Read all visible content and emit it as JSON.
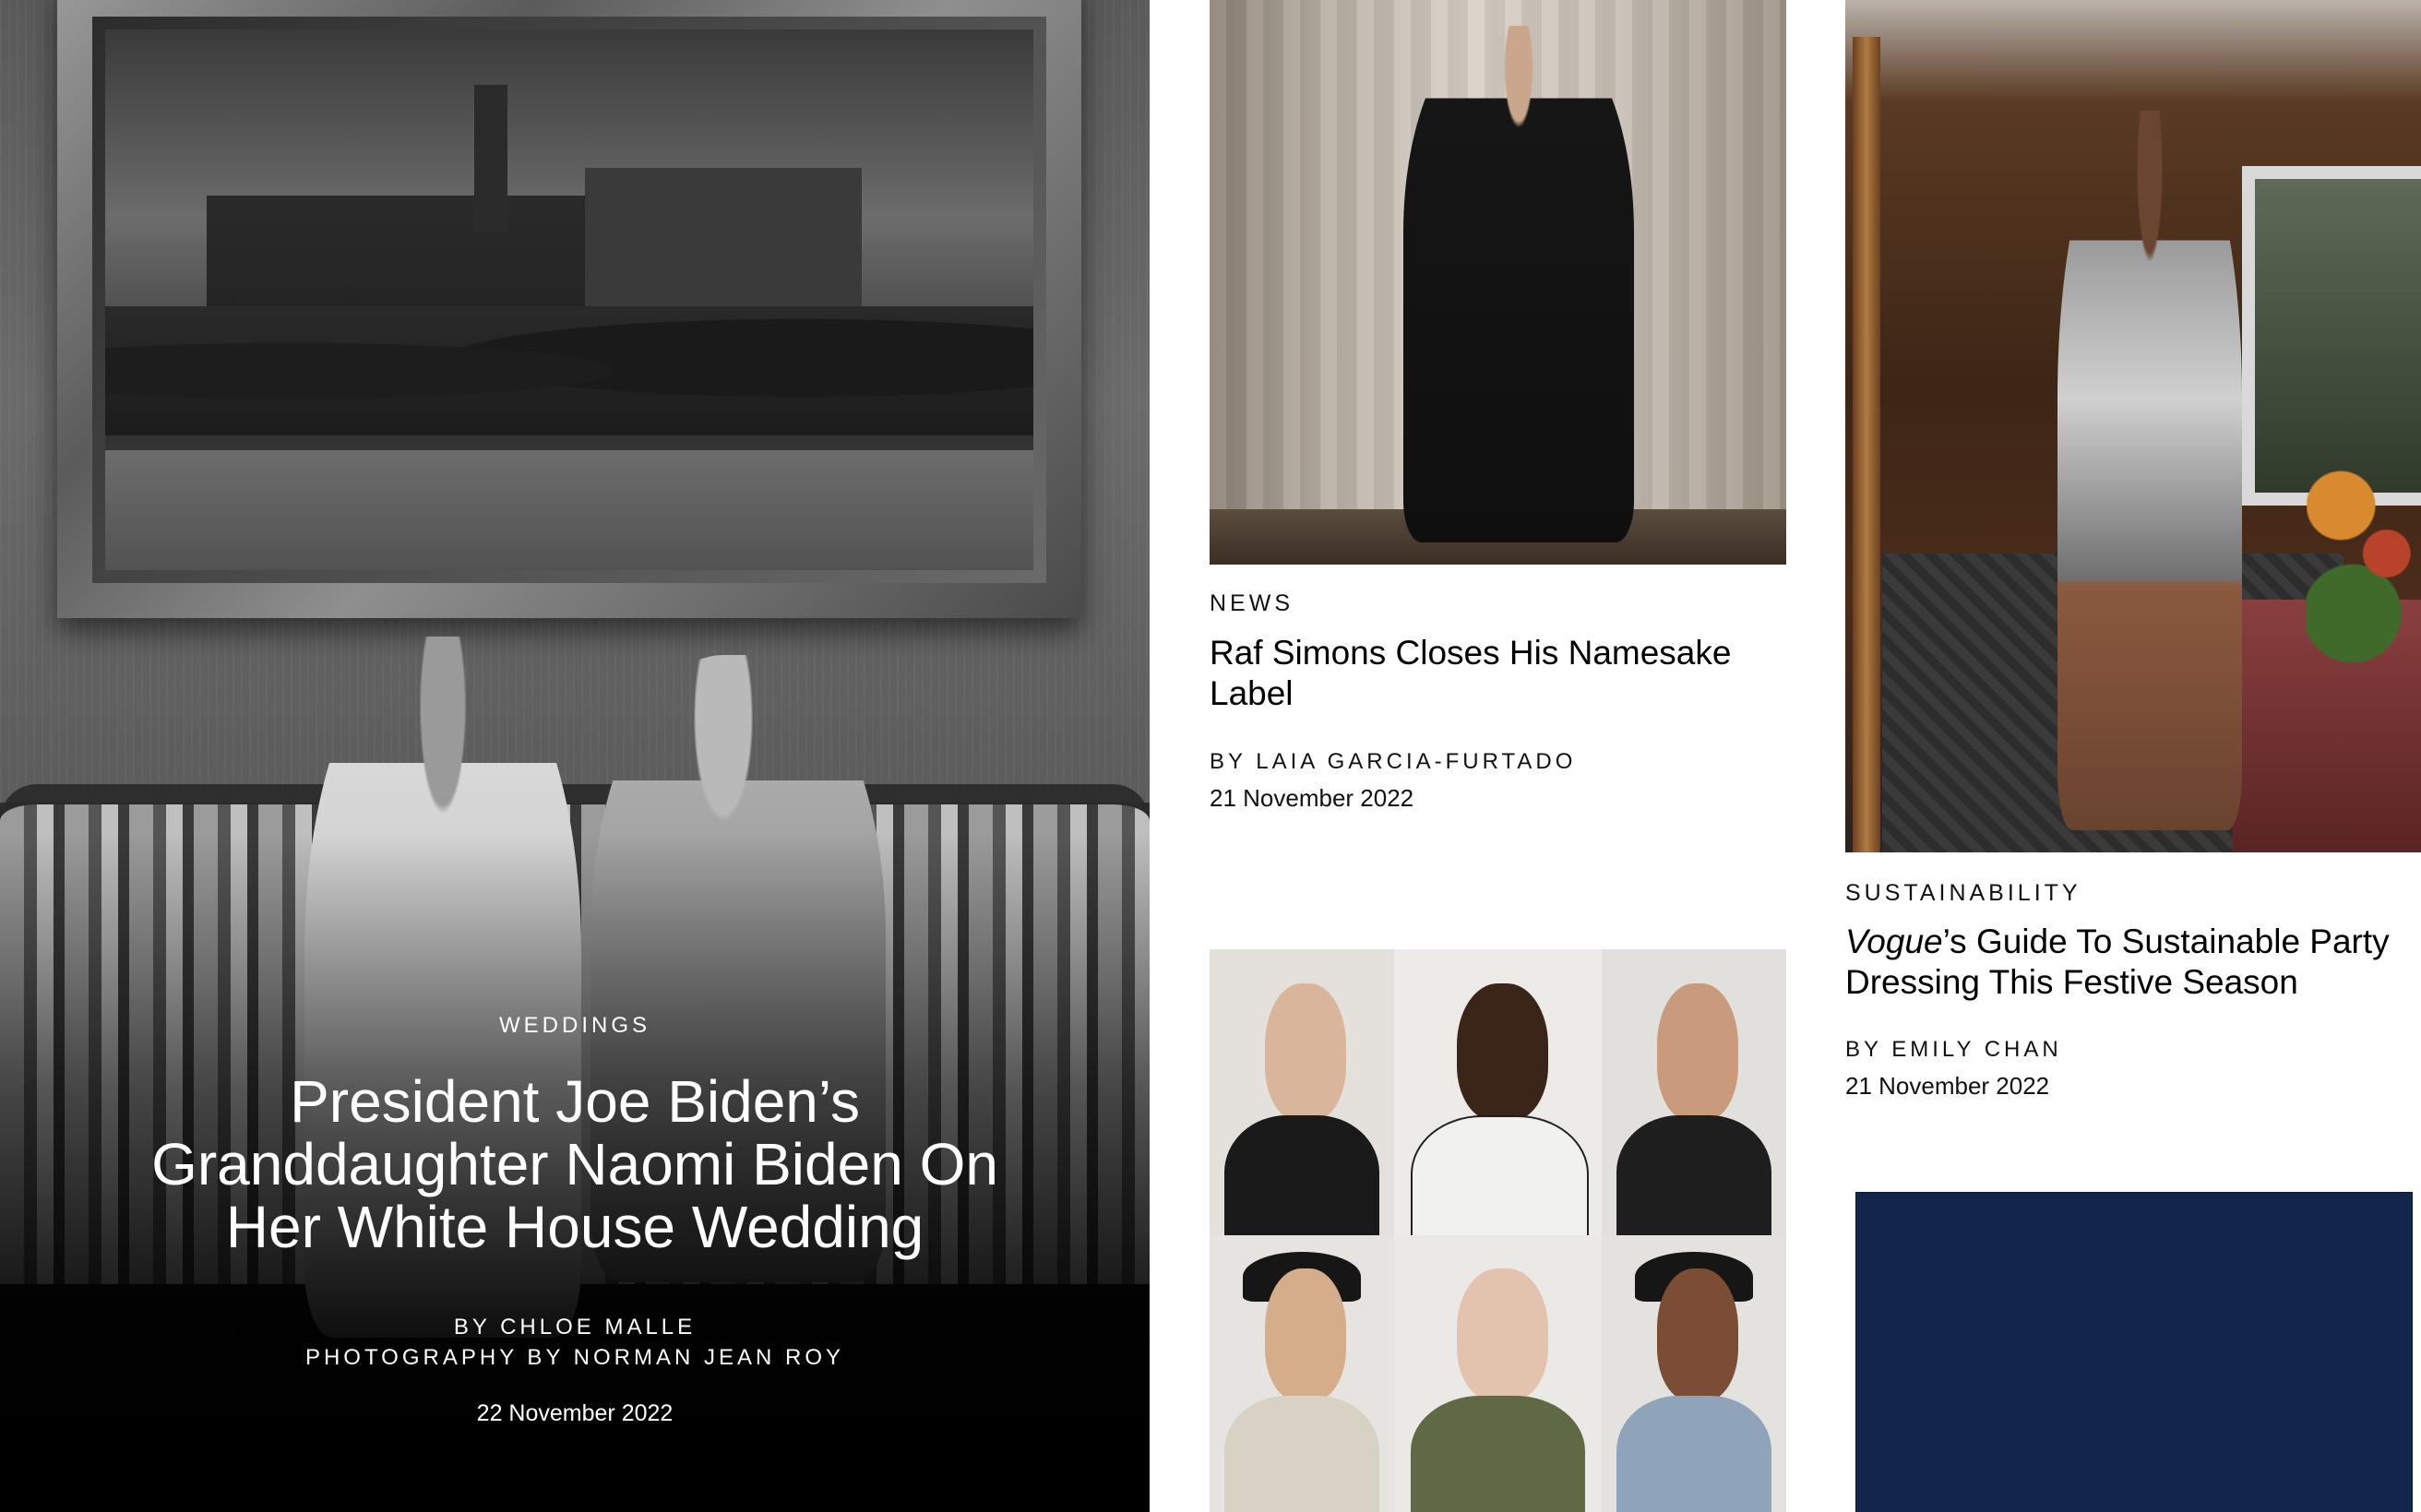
{
  "hero": {
    "rubric": "WEDDINGS",
    "headline": "President Joe Biden’s Granddaughter Naomi Biden On Her White House Wedding",
    "byline": "BY CHLOE MALLE",
    "photography": "PHOTOGRAPHY BY NORMAN JEAN ROY",
    "date": "22 November 2022"
  },
  "cards": [
    {
      "rubric": "NEWS",
      "headline": "Raf Simons Closes His Namesake Label",
      "byline": "BY LAIA GARCIA-FURTADO",
      "date": "21 November 2022"
    },
    {
      "rubric": "SUSTAINABILITY",
      "headline_italic": "Vogue",
      "headline_rest": "’s Guide To Sustainable Party Dressing This Festive Season",
      "byline": "BY EMILY CHAN",
      "date": "21 November 2022"
    }
  ],
  "colors": {
    "navy_block": "#13254a",
    "text": "#000000",
    "hero_text": "#ffffff"
  }
}
